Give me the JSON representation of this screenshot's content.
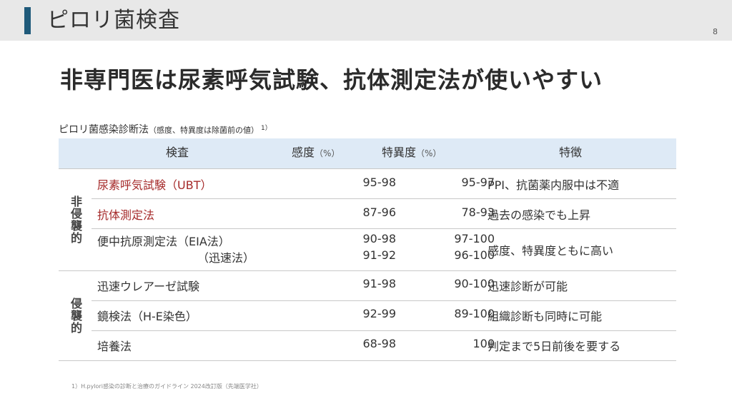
{
  "header": {
    "title": "ピロリ菌検査",
    "page_number": "8"
  },
  "headline": "非専門医は尿素呼気試験、抗体測定法が使いやすい",
  "caption": {
    "main": "ピロリ菌感染診断法",
    "note": "（感度、特異度は除菌前の値）",
    "ref": "1）"
  },
  "table": {
    "headers": {
      "test": "検査",
      "sensitivity": "感度",
      "sensitivity_unit": "（%）",
      "specificity": "特異度",
      "specificity_unit": "（%）",
      "feature": "特徴"
    },
    "groups": [
      {
        "label": "非侵襲的",
        "rows": [
          {
            "name": "尿素呼気試験（UBT）",
            "highlight": true,
            "sensitivity": "95-98",
            "specificity": "95-97",
            "feature": "PPI、抗菌薬内服中は不適"
          },
          {
            "name": "抗体測定法",
            "highlight": true,
            "sensitivity": "87-96",
            "specificity": "78-93",
            "feature": "過去の感染でも上昇"
          },
          {
            "name": "便中抗原測定法（EIA法）",
            "name2": "（迅速法）",
            "highlight": false,
            "sensitivity": "90-98",
            "sensitivity2": "91-92",
            "specificity": "97-100",
            "specificity2": "96-100",
            "feature": "感度、特異度ともに高い"
          }
        ]
      },
      {
        "label": "侵襲的",
        "rows": [
          {
            "name": "迅速ウレアーゼ試験",
            "highlight": false,
            "sensitivity": "91-98",
            "specificity": "90-100",
            "feature": "迅速診断が可能"
          },
          {
            "name": "鏡検法（H-E染色）",
            "highlight": false,
            "sensitivity": "92-99",
            "specificity": "89-100",
            "feature": "組織診断も同時に可能"
          },
          {
            "name": "培養法",
            "highlight": false,
            "sensitivity": "68-98",
            "specificity": "100",
            "feature": "判定まで5日前後を要する"
          }
        ]
      }
    ]
  },
  "footnote": "1）H.pylori感染の診断と治療のガイドライン 2024改訂版（先端医学社）",
  "colors": {
    "accent": "#1f5a7a",
    "header_bg": "#e8e8e8",
    "table_header_bg": "#deeaf6",
    "highlight_text": "#a52a2a"
  }
}
